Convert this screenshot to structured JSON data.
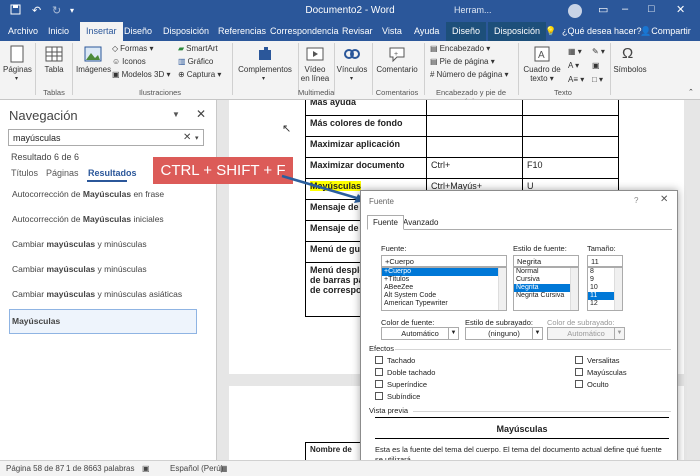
{
  "title_bar": {
    "document_title": "Documento2 - Word",
    "context_label": "Herram..."
  },
  "tabs": [
    "Archivo",
    "Inicio",
    "Insertar",
    "Diseño",
    "Disposición",
    "Referencias",
    "Correspondencia",
    "Revisar",
    "Vista",
    "Ayuda",
    "Diseño",
    "Disposición"
  ],
  "tell_me": "¿Qué desea hacer?",
  "share": "Compartir",
  "ribbon": {
    "paginas": "Páginas",
    "tabla": "Tabla",
    "imagenes": "Imágenes",
    "formas": "Formas",
    "iconos": "Iconos",
    "modelos3d": "Modelos 3D",
    "smartart": "SmartArt",
    "grafico": "Gráfico",
    "captura": "Captura",
    "complementos": "Complementos",
    "video_1": "Vídeo",
    "video_2": "en línea",
    "vinculos": "Vínculos",
    "comentario": "Comentario",
    "encabezado": "Encabezado",
    "pie": "Pie de página",
    "numero": "Número de página",
    "cuadro_1": "Cuadro de",
    "cuadro_2": "texto",
    "simbolos": "Símbolos",
    "group_tablas": "Tablas",
    "group_ilustraciones": "Ilustraciones",
    "group_multimedia": "Multimedia",
    "group_comentarios": "Comentarios",
    "group_encabezado": "Encabezado y pie de página",
    "group_texto": "Texto"
  },
  "nav": {
    "title": "Navegación",
    "search_value": "mayúsculas",
    "result_count": "Resultado 6 de 6",
    "tabs": [
      "Títulos",
      "Páginas",
      "Resultados"
    ],
    "results": [
      {
        "pre": "Autocorrección de ",
        "bold": "Mayúsculas",
        "post": " en frase"
      },
      {
        "pre": "Autocorrección de ",
        "bold": "Mayúsculas",
        "post": " iniciales"
      },
      {
        "pre": "Cambiar ",
        "bold": "mayúsculas",
        "post": " y minúsculas"
      },
      {
        "pre": "Cambiar ",
        "bold": "mayúsculas",
        "post": " y minúsculas"
      },
      {
        "pre": "Cambiar ",
        "bold": "mayúsculas",
        "post": " y minúsculas asiáticas"
      },
      {
        "pre": "",
        "bold": "Mayúsculas",
        "post": ""
      }
    ]
  },
  "doc_table": [
    [
      "Más ayuda",
      "",
      ""
    ],
    [
      "Más colores de fondo",
      "",
      ""
    ],
    [
      "Maximizar aplicación",
      "",
      ""
    ],
    [
      "Maximizar documento",
      "Ctrl+",
      "F10"
    ],
    [
      "Mayúsculas",
      "Ctrl+Mayús+",
      "U"
    ],
    [
      "Mensaje de corr",
      "",
      ""
    ],
    [
      "Mensaje de corr",
      "",
      ""
    ],
    [
      "Menú de guiones",
      "",
      ""
    ],
    [
      "Menú desplegab",
      "",
      ""
    ]
  ],
  "doc_wrap_lines": [
    "de barras para c",
    "de correspondien"
  ],
  "doc_table2_first": "Nombre de",
  "callout": "CTRL + SHIFT + F",
  "dialog": {
    "title": "Fuente",
    "help": "?",
    "tabs": [
      "Fuente",
      "Avanzado"
    ],
    "font_label": "Fuente:",
    "font_value": "+Cuerpo",
    "font_list": [
      "+Cuerpo",
      "+Títulos",
      "ABeeZee",
      "Alt System Code",
      "American Typewriter"
    ],
    "style_label": "Estilo de fuente:",
    "style_value": "Negrita",
    "style_list": [
      "Normal",
      "Cursiva",
      "Negrita",
      "Negrita Cursiva"
    ],
    "size_label": "Tamaño:",
    "size_value": "11",
    "size_list": [
      "8",
      "9",
      "10",
      "11",
      "12"
    ],
    "color_label": "Color de fuente:",
    "color_value": "Automático",
    "underline_label": "Estilo de subrayado:",
    "underline_value": "(ninguno)",
    "ucolor_label": "Color de subrayado:",
    "ucolor_value": "Automático",
    "effects_label": "Efectos",
    "effects_left": [
      "Tachado",
      "Doble tachado",
      "Superíndice",
      "Subíndice"
    ],
    "effects_right": [
      "Versalitas",
      "Mayúsculas",
      "Oculto"
    ],
    "preview_label": "Vista previa",
    "preview_text": "Mayúsculas",
    "preview_note": "Esta es la fuente del tema del cuerpo. El tema del documento actual define qué fuente se utilizará."
  },
  "status": {
    "page": "Página 58 de 87",
    "words": "1 de 8663 palabras",
    "lang": "Español (Perú)"
  },
  "colors": {
    "brand": "#2b579a",
    "callout": "#dc5b58",
    "highlight": "#ffff00",
    "selection": "#0078d7"
  }
}
